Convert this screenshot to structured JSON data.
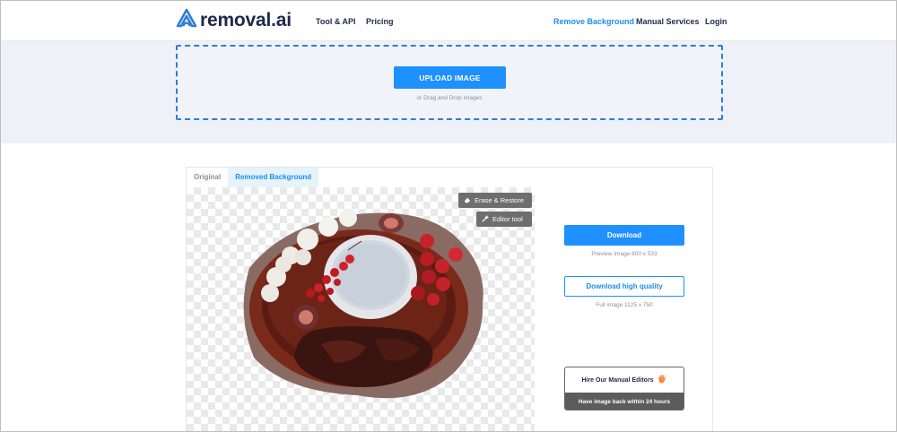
{
  "header": {
    "logo_text": "removal.ai",
    "nav_left": [
      "Tool & API",
      "Pricing"
    ],
    "nav_right": [
      "Remove Background",
      "Manual Services",
      "Login"
    ],
    "active_nav": "Remove Background"
  },
  "upload": {
    "button_label": "UPLOAD IMAGE",
    "hint": "or Drag and Drop images"
  },
  "result": {
    "tabs": [
      "Original",
      "Removed Background"
    ],
    "active_tab": "Removed Background",
    "tools": {
      "erase_restore": "Erase & Restore",
      "editor_tool": "Editor tool"
    },
    "download_label": "Download",
    "preview_meta": "Preview Image   800 x 533",
    "download_hq_label": "Download high quality",
    "full_meta": "Full image   1125 x 750",
    "hire_title": "Hire Our Manual Editors",
    "hire_sub": "Have image back within 24 hours"
  },
  "colors": {
    "accent": "#1e90ff",
    "brand_dark": "#1e2a4a",
    "band": "#eff1f8"
  },
  "icons": [
    "removal-logo-icon",
    "eraser-icon",
    "magic-wand-icon",
    "waving-hand-icon"
  ]
}
